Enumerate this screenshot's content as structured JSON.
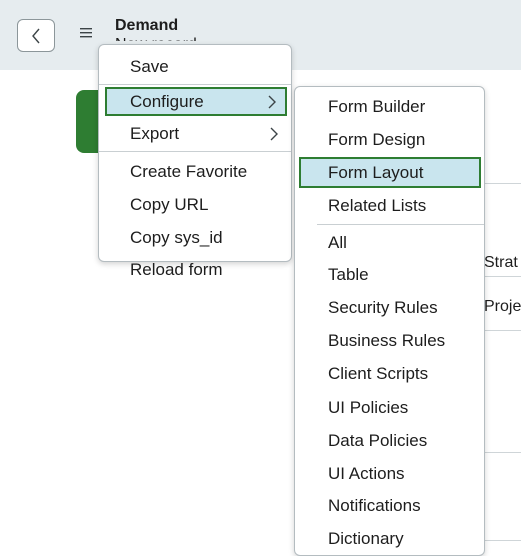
{
  "header": {
    "title": "Demand",
    "subtitle": "New record",
    "back_icon": "chevron-left-icon",
    "menu_icon": "hamburger-icon"
  },
  "background": {
    "field_text_1": "Strat",
    "field_text_2": "Proje"
  },
  "context_menu": {
    "items": [
      {
        "label": "Save"
      },
      {
        "label": "Configure",
        "has_submenu": true,
        "highlighted": true
      },
      {
        "label": "Export",
        "has_submenu": true
      },
      {
        "label": "Create Favorite"
      },
      {
        "label": "Copy URL"
      },
      {
        "label": "Copy sys_id"
      },
      {
        "label": "Reload form"
      }
    ]
  },
  "configure_submenu": {
    "items": [
      {
        "label": "Form Builder"
      },
      {
        "label": "Form Design"
      },
      {
        "label": "Form Layout",
        "highlighted": true
      },
      {
        "label": "Related Lists"
      },
      {
        "label": "All"
      },
      {
        "label": "Table"
      },
      {
        "label": "Security Rules"
      },
      {
        "label": "Business Rules"
      },
      {
        "label": "Client Scripts"
      },
      {
        "label": "UI Policies"
      },
      {
        "label": "Data Policies"
      },
      {
        "label": "UI Actions"
      },
      {
        "label": "Notifications"
      },
      {
        "label": "Dictionary"
      }
    ]
  },
  "colors": {
    "header_bg": "#e6ecef",
    "highlight_bg": "#c9e5ee",
    "highlight_border": "#2e7d32",
    "brand_green": "#2e7d32"
  }
}
